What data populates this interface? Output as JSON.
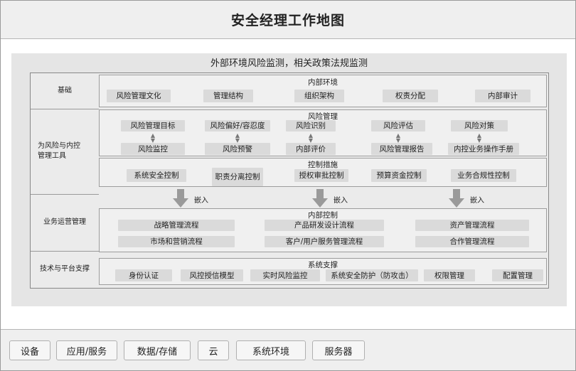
{
  "page": {
    "title": "安全经理工作地图"
  },
  "diagram": {
    "title": "外部环境风险监测，相关政策法规监测",
    "rows": {
      "basic": "基础",
      "tools": "为风险与内控管理工具",
      "ops": "业务运营管理",
      "tech": "技术与平台支撑"
    },
    "internal_env": {
      "title": "内部环境",
      "items": [
        "风险管理文化",
        "管理结构",
        "组织架构",
        "权责分配",
        "内部审计"
      ]
    },
    "risk_mgmt": {
      "title": "风险管理",
      "top": [
        "风险管理目标",
        "风险偏好/容忍度",
        "风险识别",
        "风险评估",
        "风险对策"
      ],
      "bottom": [
        "风险监控",
        "风险预警",
        "内部评价",
        "风险管理报告",
        "内控业务操作手册"
      ]
    },
    "control": {
      "title": "控制措施",
      "items": [
        "系统安全控制",
        "职责分离控制",
        "授权审批控制",
        "预算资金控制",
        "业务合规性控制"
      ]
    },
    "embed_label": "嵌入",
    "internal_control": {
      "title": "内部控制",
      "items": [
        "战略管理流程",
        "产品研发设计流程",
        "资产管理流程",
        "市场和营销流程",
        "客户/用户服务管理流程",
        "合作管理流程"
      ]
    },
    "system_support": {
      "title": "系统支撑",
      "items": [
        "身份认证",
        "风控授信模型",
        "实时风险监控",
        "系统安全防护（防攻击）",
        "权限管理",
        "配置管理"
      ]
    }
  },
  "tags": [
    "设备",
    "应用/服务",
    "数据/存储",
    "云",
    "系统环境",
    "服务器"
  ]
}
